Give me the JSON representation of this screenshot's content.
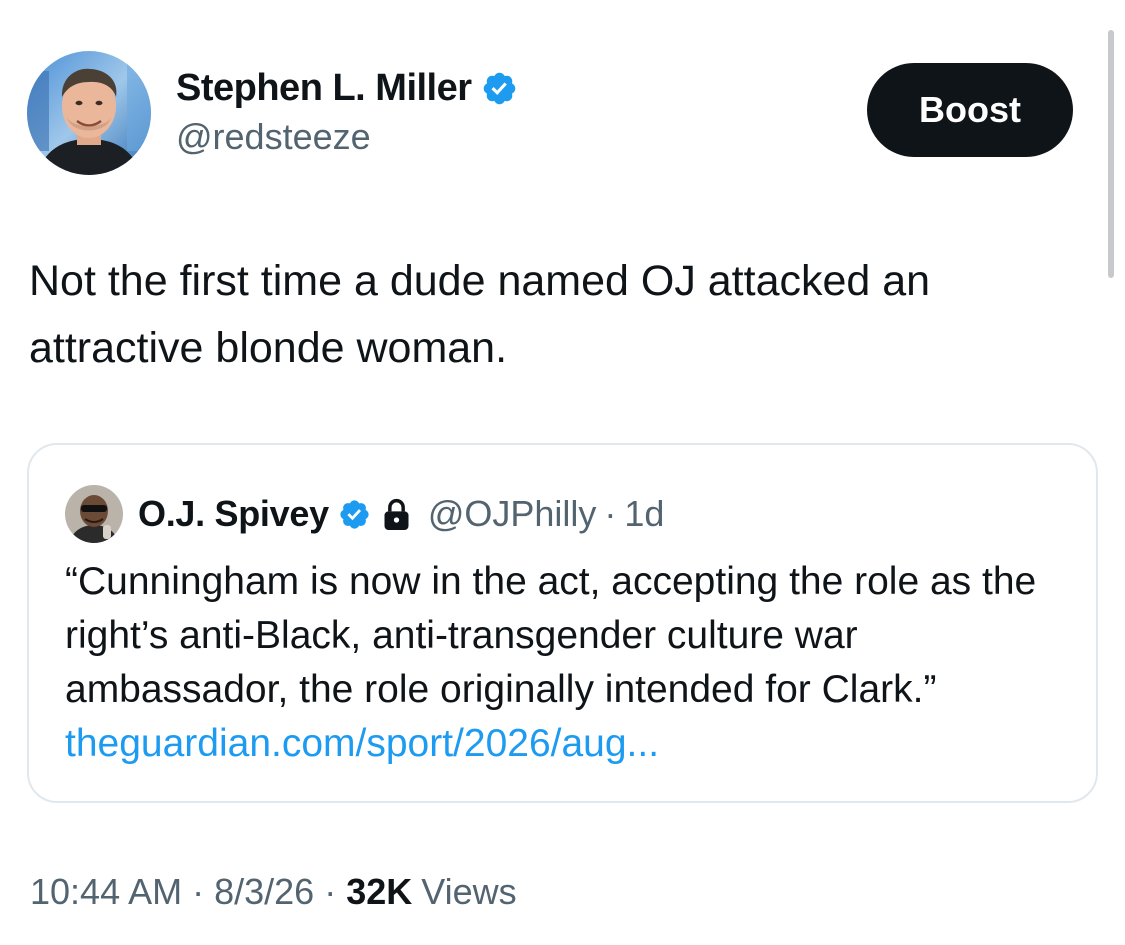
{
  "author": {
    "name": "Stephen L. Miller",
    "handle": "@redsteeze",
    "verified": true
  },
  "boost_button": {
    "label": "Boost"
  },
  "tweet": {
    "text": "Not the first time a dude named OJ attacked an attractive blonde woman."
  },
  "quoted_tweet": {
    "name": "O.J. Spivey",
    "verified": true,
    "protected": true,
    "handle": "@OJPhilly",
    "separator": "·",
    "time": "1d",
    "text": "“Cunningham is now in the act, accepting the role as the right’s anti-Black, anti-transgender culture war ambassador, the role originally intended for Clark.”",
    "link": "theguardian.com/sport/2026/aug..."
  },
  "meta": {
    "time": "10:44 AM",
    "separator": "·",
    "date": "8/3/26",
    "views_count": "32K",
    "views_label": "Views"
  },
  "icons": {
    "verified": "verified-badge-icon",
    "lock": "lock-icon"
  },
  "colors": {
    "text": "#0f1419",
    "secondary": "#536471",
    "link": "#1d9bf0",
    "verified": "#1d9bf0",
    "button_bg": "#0f1419",
    "border": "#e1e8ed"
  }
}
